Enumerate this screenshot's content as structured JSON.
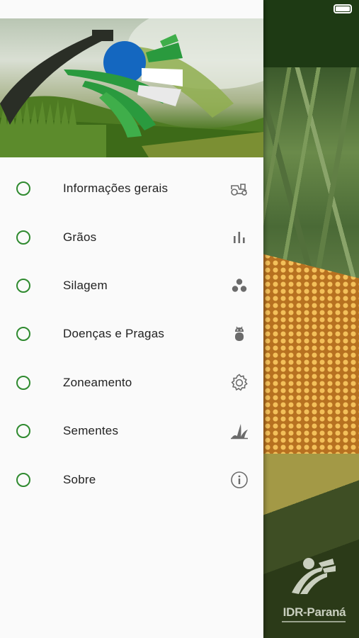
{
  "menu": {
    "items": [
      {
        "label": "Informações gerais",
        "icon": "tractor-icon"
      },
      {
        "label": "Grãos",
        "icon": "bar-chart-icon"
      },
      {
        "label": "Silagem",
        "icon": "three-dots-cluster-icon"
      },
      {
        "label": "Doenças e Pragas",
        "icon": "bug-icon"
      },
      {
        "label": "Zoneamento",
        "icon": "gear-icon"
      },
      {
        "label": "Sementes",
        "icon": "sprout-icon"
      },
      {
        "label": "Sobre",
        "icon": "info-icon"
      }
    ]
  },
  "brand": {
    "name": "IDR-Paraná",
    "accent": "#2f8a2f",
    "drawer_bg": "#fafafa",
    "icon_color": "#6b6b6b"
  }
}
